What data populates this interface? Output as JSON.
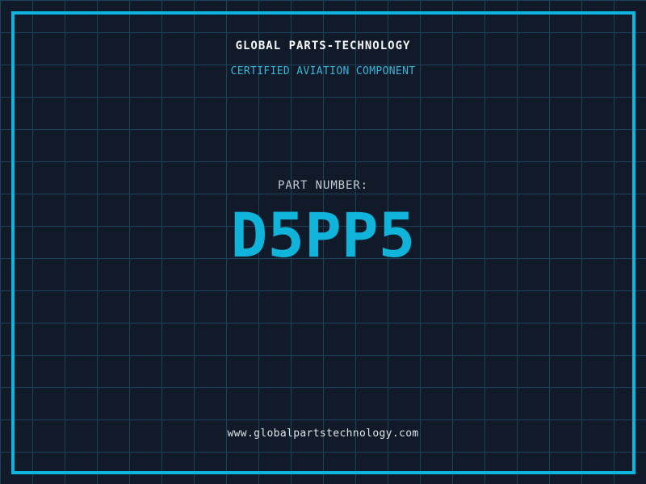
{
  "header": {
    "title": "GLOBAL PARTS-TECHNOLOGY",
    "subtitle": "CERTIFIED AVIATION COMPONENT"
  },
  "part": {
    "label": "PART NUMBER:",
    "number": "D5PP5"
  },
  "footer": {
    "website": "www.globalpartstechnology.com"
  },
  "colors": {
    "background": "#101a29",
    "grid_line": "#1d4156",
    "border": "#0bb5dd",
    "title": "#f5f7f8",
    "subtitle": "#38b5d8",
    "label": "#c3cbd2",
    "part_number": "#10b4da",
    "url": "#dde3e7"
  }
}
